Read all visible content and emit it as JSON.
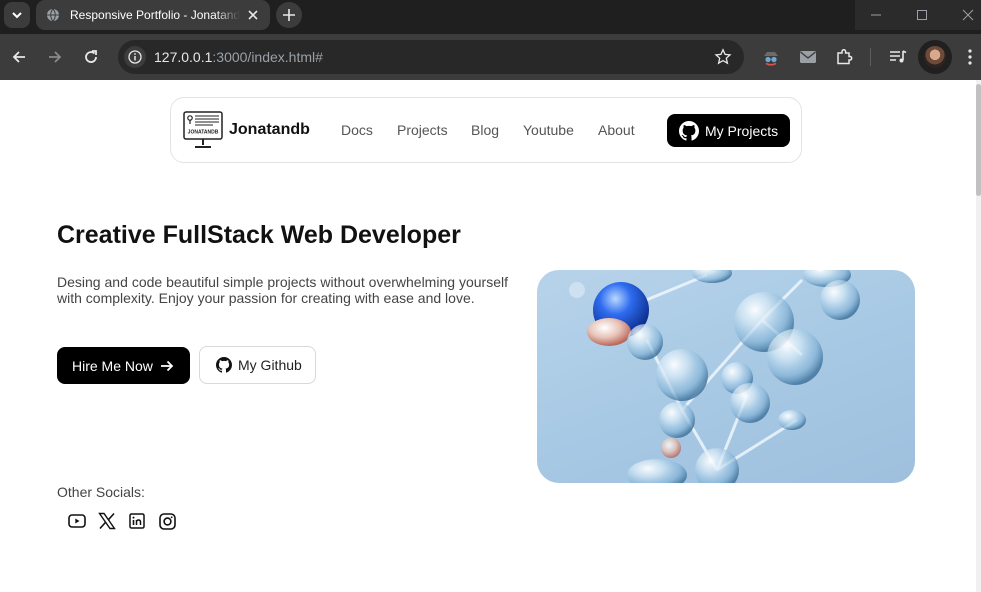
{
  "browser": {
    "tab_title": "Responsive Portfolio - Jonatandb",
    "url_host": "127.0.0.1",
    "url_rest": ":3000/index.html#"
  },
  "nav": {
    "brand": "Jonatandb",
    "logo_text": "JONATANDB",
    "links": [
      "Docs",
      "Projects",
      "Blog",
      "Youtube",
      "About"
    ],
    "cta_label": "My Projects"
  },
  "hero": {
    "title": "Creative FullStack Web Developer",
    "description": "Desing and code beautiful simple projects without overwhelming yourself with complexity. Enjoy your passion for creating with ease and love.",
    "primary_button": "Hire Me Now",
    "secondary_button": "My Github"
  },
  "socials": {
    "label": "Other Socials:",
    "items": [
      "youtube-icon",
      "x-icon",
      "linkedin-icon",
      "instagram-icon"
    ]
  },
  "colors": {
    "chrome_dark": "#1f1f1f",
    "chrome_toolbar": "#3c3c3c",
    "accent_black": "#000000",
    "image_sky": "#a8c9e4"
  }
}
